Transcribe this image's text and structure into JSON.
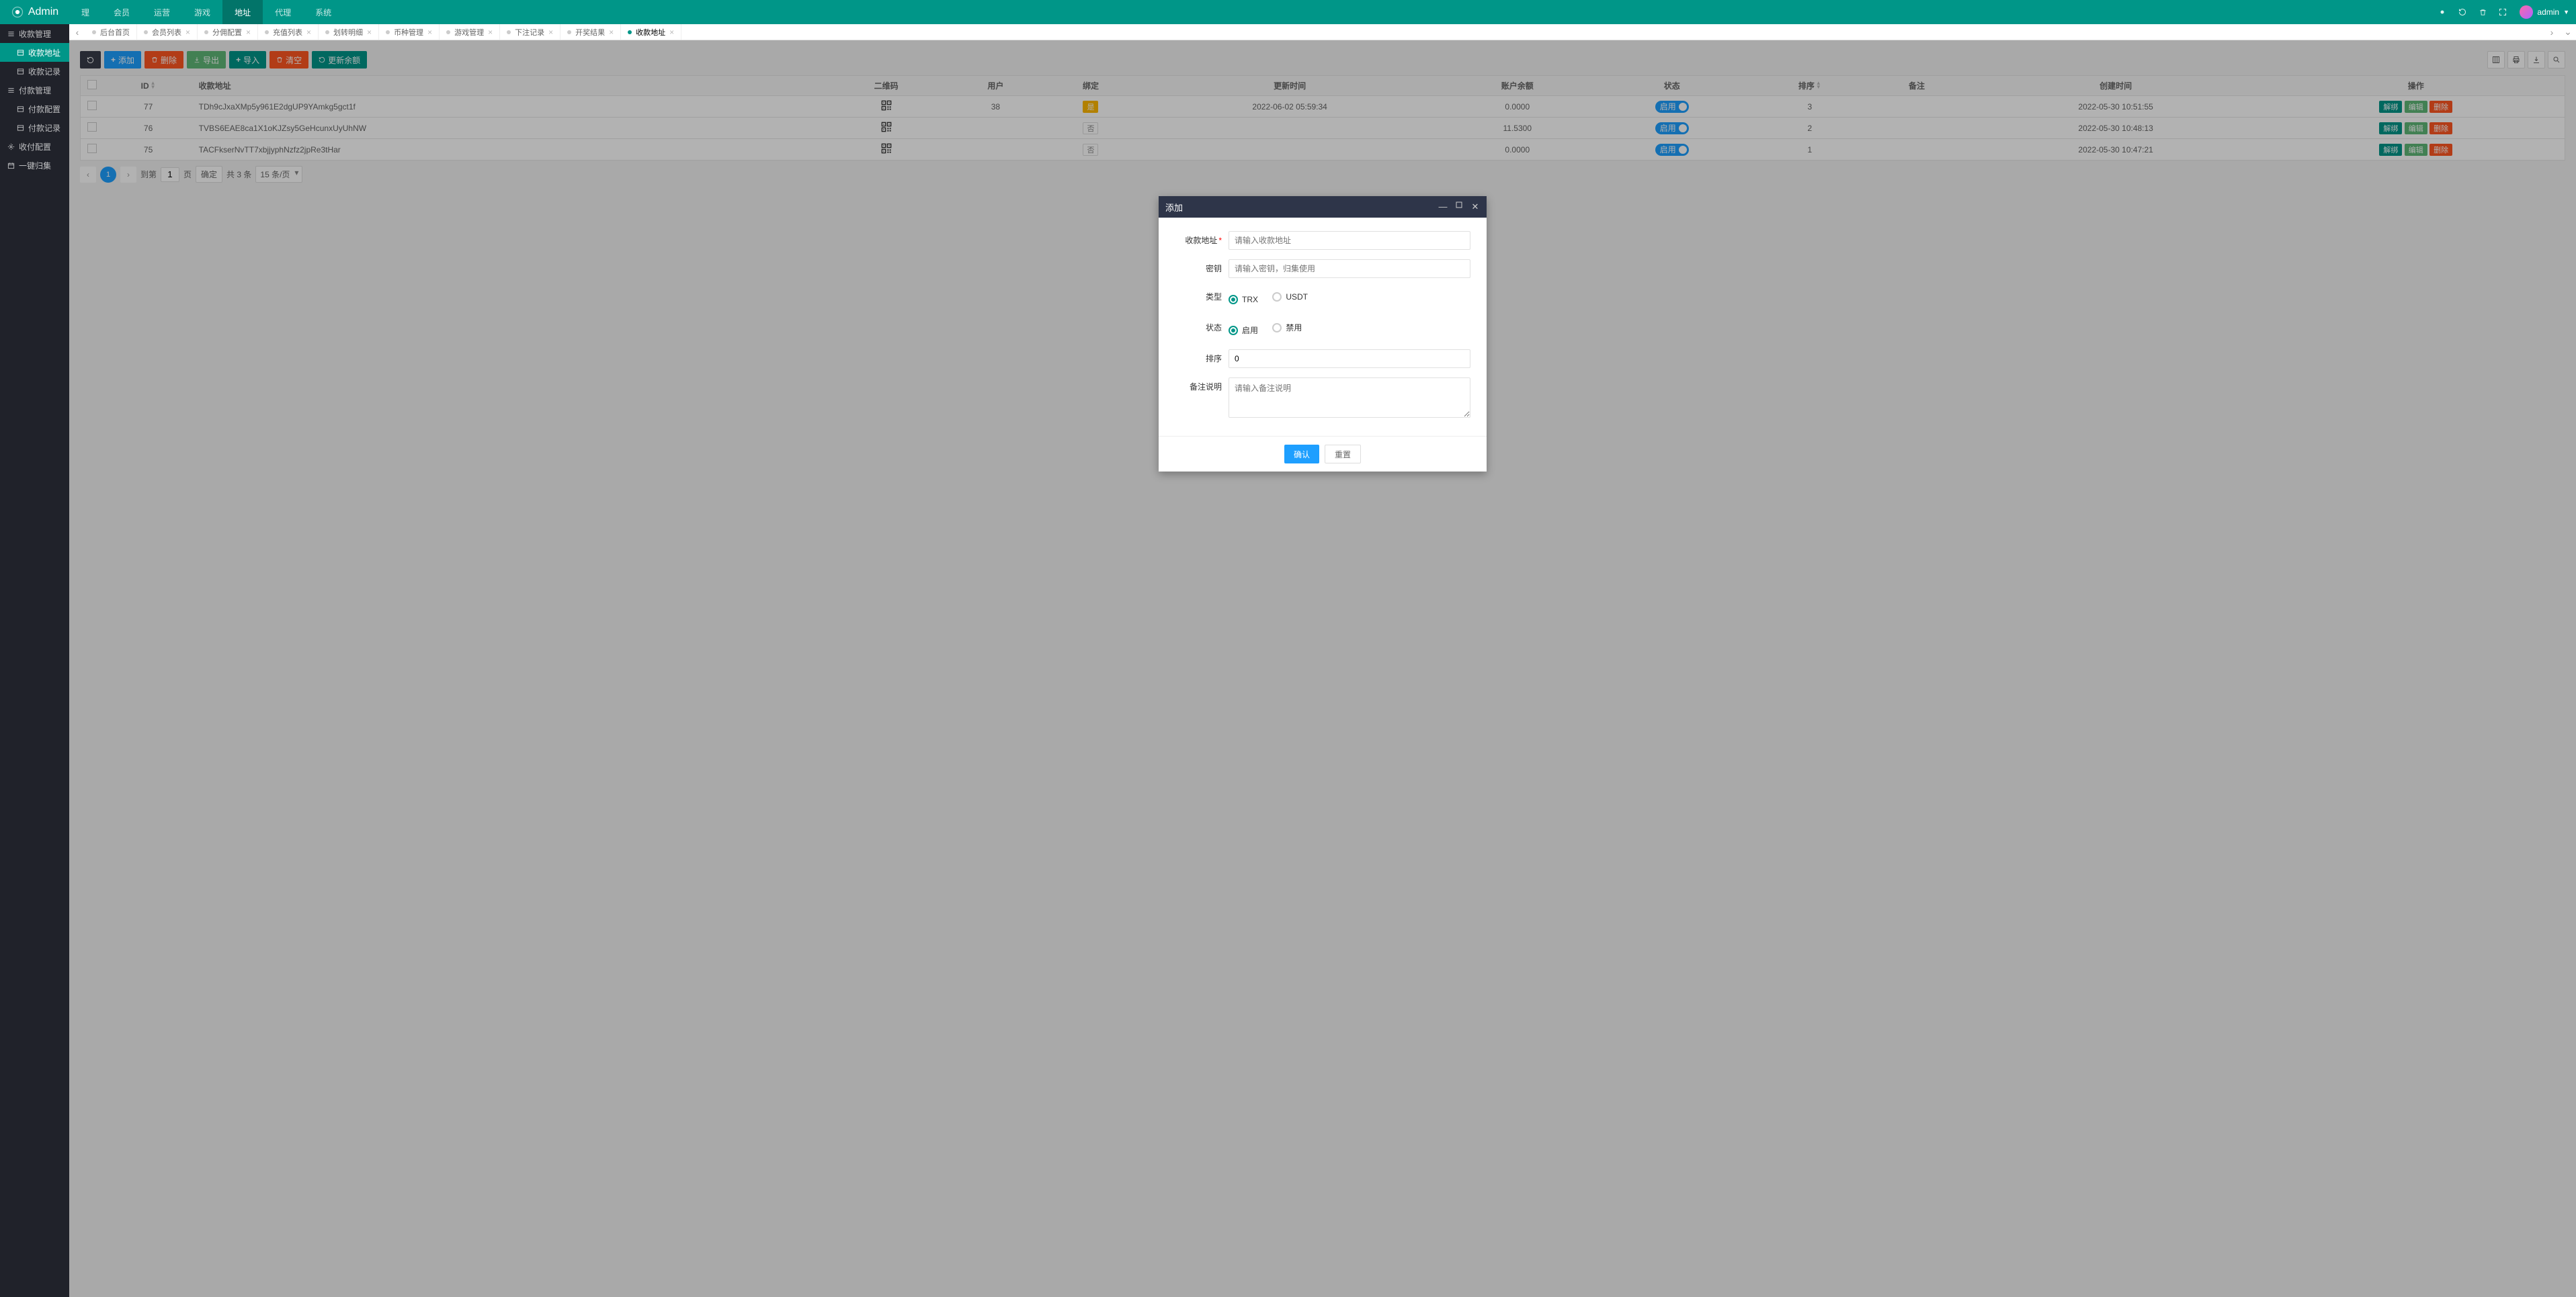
{
  "brand": "Admin",
  "user_name": "admin",
  "topnav": [
    "理",
    "会员",
    "运营",
    "游戏",
    "地址",
    "代理",
    "系统"
  ],
  "topnav_active": 4,
  "sidebar": [
    {
      "label": "收款管理",
      "icon": "bars",
      "sub": false
    },
    {
      "label": "收款地址",
      "icon": "list",
      "sub": true,
      "active": true
    },
    {
      "label": "收款记录",
      "icon": "list",
      "sub": true
    },
    {
      "label": "付款管理",
      "icon": "bars",
      "sub": false
    },
    {
      "label": "付款配置",
      "icon": "list",
      "sub": true
    },
    {
      "label": "付款记录",
      "icon": "list",
      "sub": true
    },
    {
      "label": "收付配置",
      "icon": "gear",
      "sub": false
    },
    {
      "label": "一键归集",
      "icon": "calendar",
      "sub": false
    }
  ],
  "tabs": [
    {
      "label": "后台首页",
      "closable": false
    },
    {
      "label": "会员列表",
      "closable": true
    },
    {
      "label": "分佣配置",
      "closable": true
    },
    {
      "label": "充值列表",
      "closable": true
    },
    {
      "label": "划转明细",
      "closable": true
    },
    {
      "label": "币种管理",
      "closable": true
    },
    {
      "label": "游戏管理",
      "closable": true
    },
    {
      "label": "下注记录",
      "closable": true
    },
    {
      "label": "开奖结果",
      "closable": true
    },
    {
      "label": "收款地址",
      "closable": true,
      "active": true
    }
  ],
  "toolbar": {
    "refresh": "",
    "add": "添加",
    "delete": "删除",
    "export": "导出",
    "import": "导入",
    "clear": "清空",
    "updateBal": "更新余额"
  },
  "columns": [
    "",
    "ID",
    "收款地址",
    "二维码",
    "用户",
    "绑定",
    "更新时间",
    "账户余额",
    "状态",
    "排序",
    "备注",
    "创建时间",
    "操作"
  ],
  "rows": [
    {
      "id": "77",
      "addr": "TDh9cJxaXMp5y961E2dgUP9YAmkg5gct1f",
      "user": "38",
      "bind": "是",
      "bind_type": "warn",
      "updated": "2022-06-02 05:59:34",
      "bal": "0.0000",
      "status": "启用",
      "sort": "3",
      "remark": "",
      "created": "2022-05-30 10:51:55"
    },
    {
      "id": "76",
      "addr": "TVBS6EAE8ca1X1oKJZsy5GeHcunxUyUhNW",
      "user": "",
      "bind": "否",
      "bind_type": "gray",
      "updated": "",
      "bal": "11.5300",
      "status": "启用",
      "sort": "2",
      "remark": "",
      "created": "2022-05-30 10:48:13"
    },
    {
      "id": "75",
      "addr": "TACFkserNvTT7xbjjyphNzfz2jpRe3tHar",
      "user": "",
      "bind": "否",
      "bind_type": "gray",
      "updated": "",
      "bal": "0.0000",
      "status": "启用",
      "sort": "1",
      "remark": "",
      "created": "2022-05-30 10:47:21"
    }
  ],
  "row_actions": {
    "unbind": "解绑",
    "edit": "编辑",
    "del": "删除"
  },
  "pager": {
    "page": "1",
    "goto_label": "到第",
    "page_unit": "页",
    "confirm": "确定",
    "total": "共 3 条",
    "perpage": "15 条/页"
  },
  "modal": {
    "title": "添加",
    "fields": {
      "addr": {
        "label": "收款地址",
        "placeholder": "请输入收款地址",
        "required": true
      },
      "key": {
        "label": "密钥",
        "placeholder": "请输入密钥，归集使用"
      },
      "type": {
        "label": "类型",
        "opts": [
          "TRX",
          "USDT"
        ],
        "value": "TRX"
      },
      "status": {
        "label": "状态",
        "opts": [
          "启用",
          "禁用"
        ],
        "value": "启用"
      },
      "sort": {
        "label": "排序",
        "value": "0"
      },
      "remark": {
        "label": "备注说明",
        "placeholder": "请输入备注说明"
      }
    },
    "confirm": "确认",
    "reset": "重置"
  }
}
